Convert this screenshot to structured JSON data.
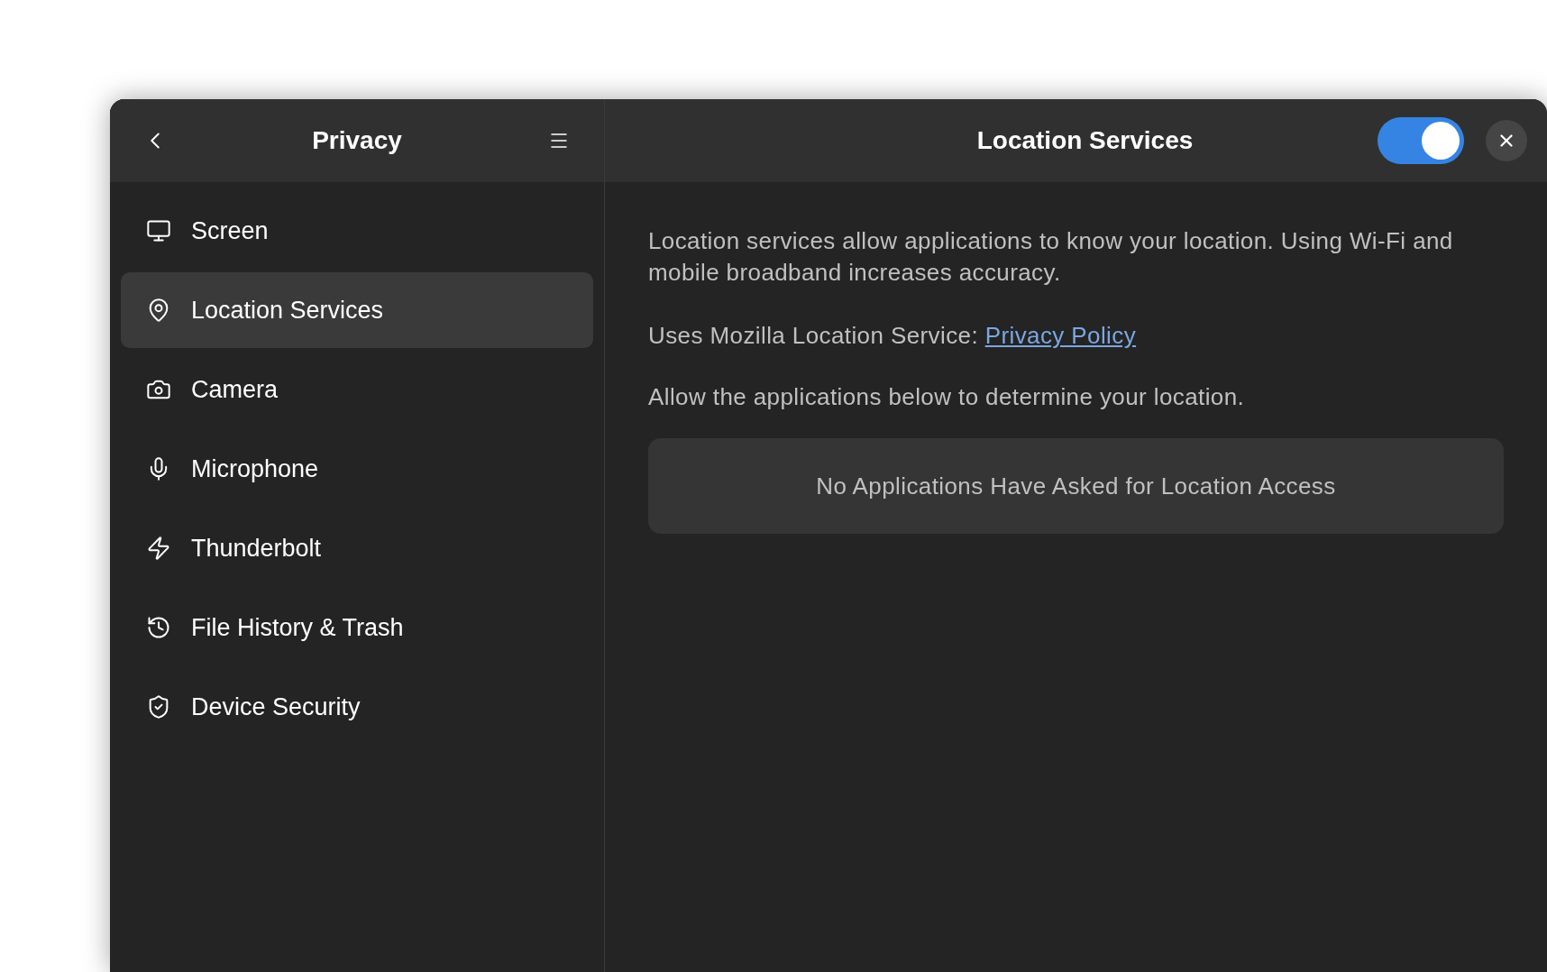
{
  "sidebar": {
    "title": "Privacy",
    "items": [
      {
        "label": "Screen",
        "selected": false
      },
      {
        "label": "Location Services",
        "selected": true
      },
      {
        "label": "Camera",
        "selected": false
      },
      {
        "label": "Microphone",
        "selected": false
      },
      {
        "label": "Thunderbolt",
        "selected": false
      },
      {
        "label": "File History & Trash",
        "selected": false
      },
      {
        "label": "Device Security",
        "selected": false
      }
    ]
  },
  "content": {
    "title": "Location Services",
    "toggle": {
      "on": true
    },
    "description": "Location services allow applications to know your location. Using Wi-Fi and mobile broadband increases accuracy.",
    "service_label": "Uses Mozilla Location Service:",
    "link": "Privacy Policy",
    "allow_text": "Allow the applications below to determine your location.",
    "empty_message": "No Applications Have Asked for Location Access"
  }
}
